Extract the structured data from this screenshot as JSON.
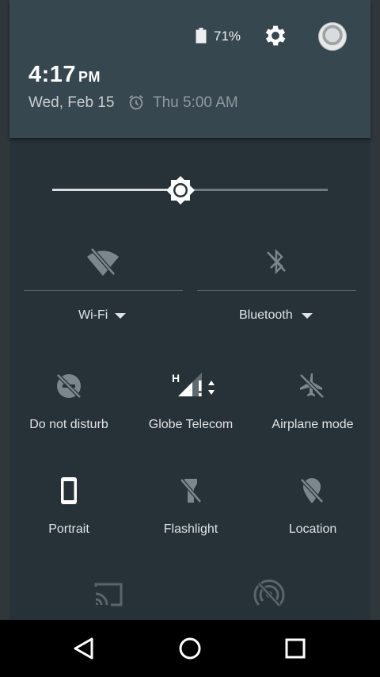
{
  "status": {
    "battery_percent": "71%",
    "battery_level": 0.71
  },
  "header": {
    "time": "4:17",
    "ampm": "PM",
    "date": "Wed, Feb 15",
    "alarm": "Thu 5:00 AM"
  },
  "brightness": {
    "level": 0.43
  },
  "toggles": [
    {
      "label": "Wi-Fi",
      "icon": "wifi-off-icon",
      "has_dropdown": true
    },
    {
      "label": "Bluetooth",
      "icon": "bluetooth-off-icon",
      "has_dropdown": true
    }
  ],
  "tiles": [
    {
      "label": "Do not disturb",
      "icon": "do-not-disturb-off-icon"
    },
    {
      "label": "Globe Telecom",
      "icon": "cell-signal-icon",
      "network_type": "H"
    },
    {
      "label": "Airplane mode",
      "icon": "airplane-off-icon"
    },
    {
      "label": "Portrait",
      "icon": "portrait-phone-icon"
    },
    {
      "label": "Flashlight",
      "icon": "flashlight-off-icon"
    },
    {
      "label": "Location",
      "icon": "location-off-icon"
    }
  ],
  "extra_tiles": [
    {
      "icon": "cast-icon"
    },
    {
      "icon": "hotspot-off-icon"
    }
  ],
  "colors": {
    "shade_bg": "#263238",
    "header_bg": "#37474f",
    "icon_active": "#ffffff",
    "icon_inactive": "#7c878c"
  },
  "nav": [
    "back-icon",
    "home-icon",
    "recents-icon"
  ]
}
